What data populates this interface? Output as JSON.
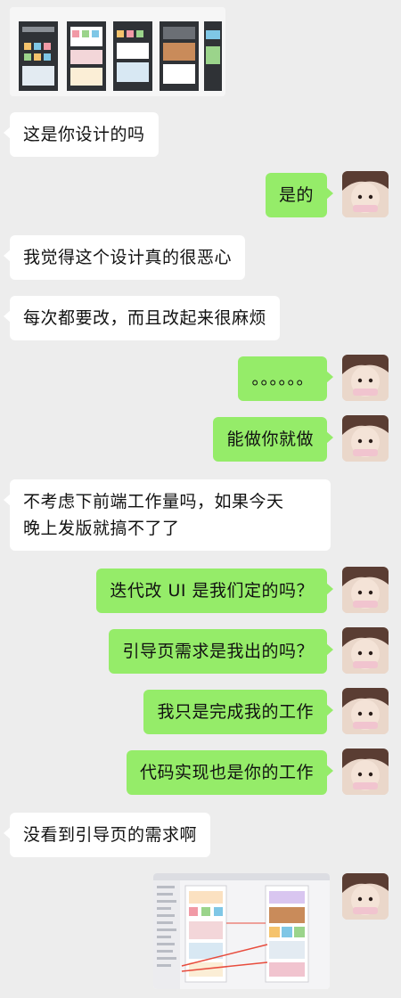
{
  "chat": {
    "messages": [
      {
        "side": "left",
        "text": "这是你设计的吗"
      },
      {
        "side": "right",
        "text": "是的"
      },
      {
        "side": "left",
        "text": "我觉得这个设计真的很恶心"
      },
      {
        "side": "left",
        "text": "每次都要改，而且改起来很麻烦"
      },
      {
        "side": "right",
        "text": "。。。。。。"
      },
      {
        "side": "right",
        "text": "能做你就做"
      },
      {
        "side": "left",
        "text": "不考虑下前端工作量吗，如果今天\n晚上发版就搞不了了"
      },
      {
        "side": "right",
        "text": "迭代改 UI 是我们定的吗？"
      },
      {
        "side": "right",
        "text": "引导页需求是我出的吗？"
      },
      {
        "side": "right",
        "text": "我只是完成我的工作"
      },
      {
        "side": "right",
        "text": "代码实现也是你的工作"
      },
      {
        "side": "left",
        "text": "没看到引导页的需求啊"
      }
    ]
  },
  "colors": {
    "background": "#ededed",
    "incoming_bubble": "#ffffff",
    "outgoing_bubble": "#95ec69"
  },
  "icons": {
    "avatar": "avatar-photo",
    "image_message": "design-screenshot"
  }
}
